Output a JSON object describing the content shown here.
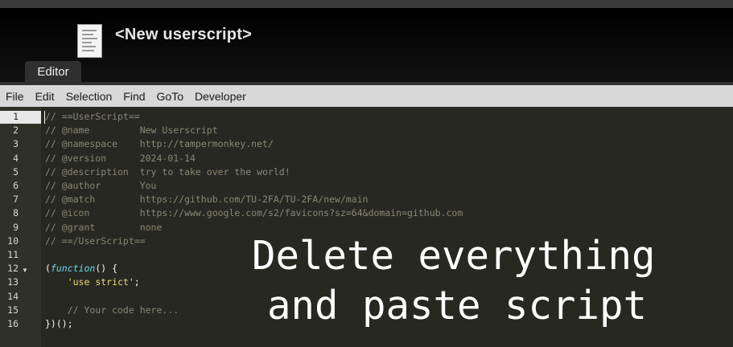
{
  "header": {
    "title": "<New userscript>",
    "icon": "document-icon"
  },
  "tabs": [
    {
      "label": "Editor",
      "active": true
    }
  ],
  "menu": [
    "File",
    "Edit",
    "Selection",
    "Find",
    "GoTo",
    "Developer"
  ],
  "editor": {
    "active_line": 1,
    "line_numbers": [
      "1",
      "2",
      "3",
      "4",
      "5",
      "6",
      "7",
      "8",
      "9",
      "10",
      "11",
      "12",
      "13",
      "14",
      "15",
      "16"
    ],
    "fold_marker_line": "12",
    "lines": [
      "// ==UserScript==",
      "// @name         New Userscript",
      "// @namespace    http://tampermonkey.net/",
      "// @version      2024-01-14",
      "// @description  try to take over the world!",
      "// @author       You",
      "// @match        https://github.com/TU-2FA/TU-2FA/new/main",
      "// @icon         https://www.google.com/s2/favicons?sz=64&domain=github.com",
      "// @grant        none",
      "// ==/UserScript==",
      "",
      {
        "open": "(",
        "kw": "function",
        "rest": "() {"
      },
      {
        "indent": "    ",
        "str": "'use strict'",
        "rest": ";"
      },
      "",
      "    // Your code here...",
      "})();"
    ]
  },
  "overlay": {
    "line1": "Delete everything",
    "line2": "and paste script"
  },
  "colors": {
    "editor_bg": "#272822",
    "comment": "#8a8773",
    "keyword": "#66d9ef",
    "string": "#e6db74",
    "menubar_bg": "#d8d8d8"
  }
}
